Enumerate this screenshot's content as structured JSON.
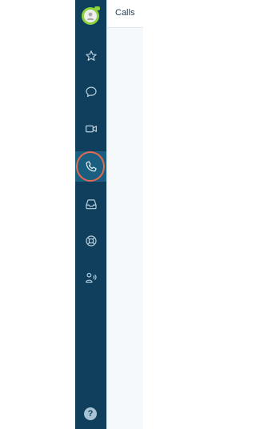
{
  "app": {
    "colors": {
      "rail_bg": "#0f3f5c",
      "rail_active_bg": "#1b5f80",
      "accent_green": "#8ed23d",
      "highlight_ring": "#e56a4f"
    }
  },
  "header": {
    "title": "Calls"
  },
  "sidebar": {
    "items": [
      {
        "icon": "star-icon"
      },
      {
        "icon": "chat-bubble-icon"
      },
      {
        "icon": "video-camera-icon"
      },
      {
        "icon": "phone-icon",
        "active": true
      },
      {
        "icon": "inbox-tray-icon"
      },
      {
        "icon": "lifebuoy-icon"
      },
      {
        "icon": "person-signal-icon"
      }
    ],
    "help_label": "?"
  }
}
